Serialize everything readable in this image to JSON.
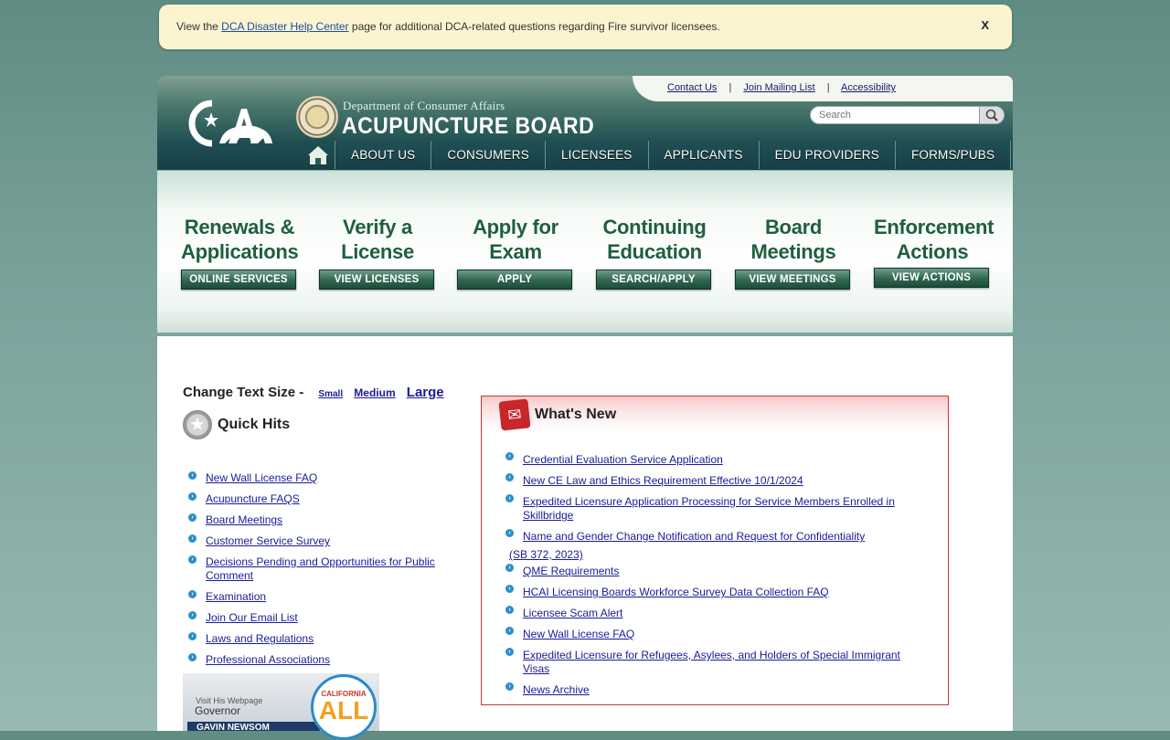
{
  "alert": {
    "prefix": "View the",
    "link": "DCA Disaster Help Center",
    "suffix": "page for additional DCA-related questions regarding Fire survivor licensees.",
    "close": "X"
  },
  "header": {
    "topbar": {
      "contact": "Contact Us",
      "mailing": "Join Mailing List",
      "accessibility": "Accessibility",
      "sep": "|"
    },
    "search_placeholder": "Search",
    "dept": "Department of Consumer Affairs",
    "board": "ACUPUNCTURE BOARD",
    "nav": [
      "ABOUT US",
      "CONSUMERS",
      "LICENSEES",
      "APPLICANTS",
      "EDU PROVIDERS",
      "FORMS/PUBS"
    ]
  },
  "tiles": [
    {
      "line1": "Renewals &",
      "line2": "Applications",
      "button": "ONLINE SERVICES"
    },
    {
      "line1": "Verify a",
      "line2": "License",
      "button": "VIEW LICENSES"
    },
    {
      "line1": "Apply for",
      "line2": "Exam",
      "button": "APPLY"
    },
    {
      "line1": "Continuing",
      "line2": "Education",
      "button": "SEARCH/APPLY"
    },
    {
      "line1": "Board",
      "line2": "Meetings",
      "button": "VIEW MEETINGS"
    },
    {
      "line1": "Enforcement",
      "line2": "Actions",
      "button": "VIEW ACTIONS"
    }
  ],
  "textsize": {
    "label": "Change Text Size -",
    "small": "Small",
    "medium": "Medium",
    "large": "Large"
  },
  "quick_hits": {
    "title": "Quick Hits",
    "items": [
      "New Wall License FAQ",
      "Acupuncture FAQS",
      "Board Meetings",
      "Customer Service Survey",
      "Decisions Pending and Opportunities for Public Comment",
      "Examination",
      "Join Our Email List",
      "Laws and Regulations",
      "Professional Associations"
    ]
  },
  "governor": {
    "l1": "Visit His Webpage",
    "l2": "Governor",
    "l3": "GAVIN NEWSOM",
    "badge_top": "CALIFORNIA",
    "badge_main": "ALL"
  },
  "whats_new": {
    "title": "What's New",
    "items": [
      "Credential Evaluation Service Application",
      "New CE Law and Ethics Requirement Effective 10/1/2024",
      "Expedited Licensure Application Processing for Service Members Enrolled in Skillbridge",
      "Name and Gender Change Notification and Request for Confidentiality",
      "QME Requirements",
      "HCAI Licensing Boards Workforce Survey Data Collection FAQ",
      "Licensee Scam Alert",
      "New Wall License FAQ",
      "Expedited Licensure for Refugees, Asylees, and Holders of Special Immigrant Visas",
      "News Archive"
    ],
    "item3_cont": "(SB 372, 2023)"
  }
}
